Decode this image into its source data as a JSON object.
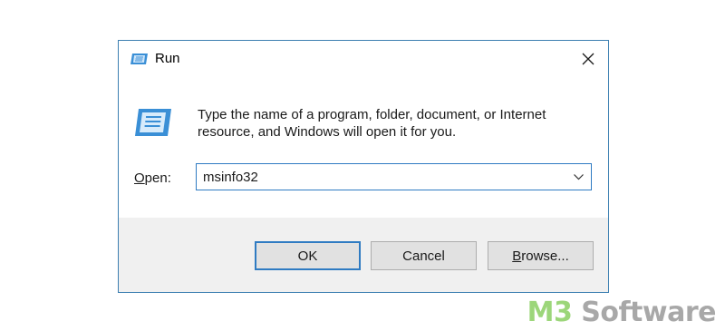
{
  "dialog": {
    "title": "Run",
    "description_line1": "Type the name of a program, folder, document, or Internet",
    "description_line2": "resource, and Windows will open it for you.",
    "open_label_mnemonic": "O",
    "open_label_rest": "pen:",
    "input_value": "msinfo32",
    "buttons": {
      "ok": "OK",
      "cancel": "Cancel",
      "browse_mnemonic": "B",
      "browse_rest": "rowse..."
    }
  },
  "icons": {
    "title": "run-app-icon",
    "large": "run-app-icon",
    "close": "close-icon",
    "dropdown": "chevron-down-icon"
  },
  "watermark": {
    "part1": "M3",
    "part2": " Software"
  },
  "colors": {
    "accent_border": "#2f7bc2",
    "window_border": "#3c7fb1",
    "footer_bg": "#f0f0f0",
    "brand_green": "#9cd67a",
    "brand_gray": "#a8a8a8"
  }
}
